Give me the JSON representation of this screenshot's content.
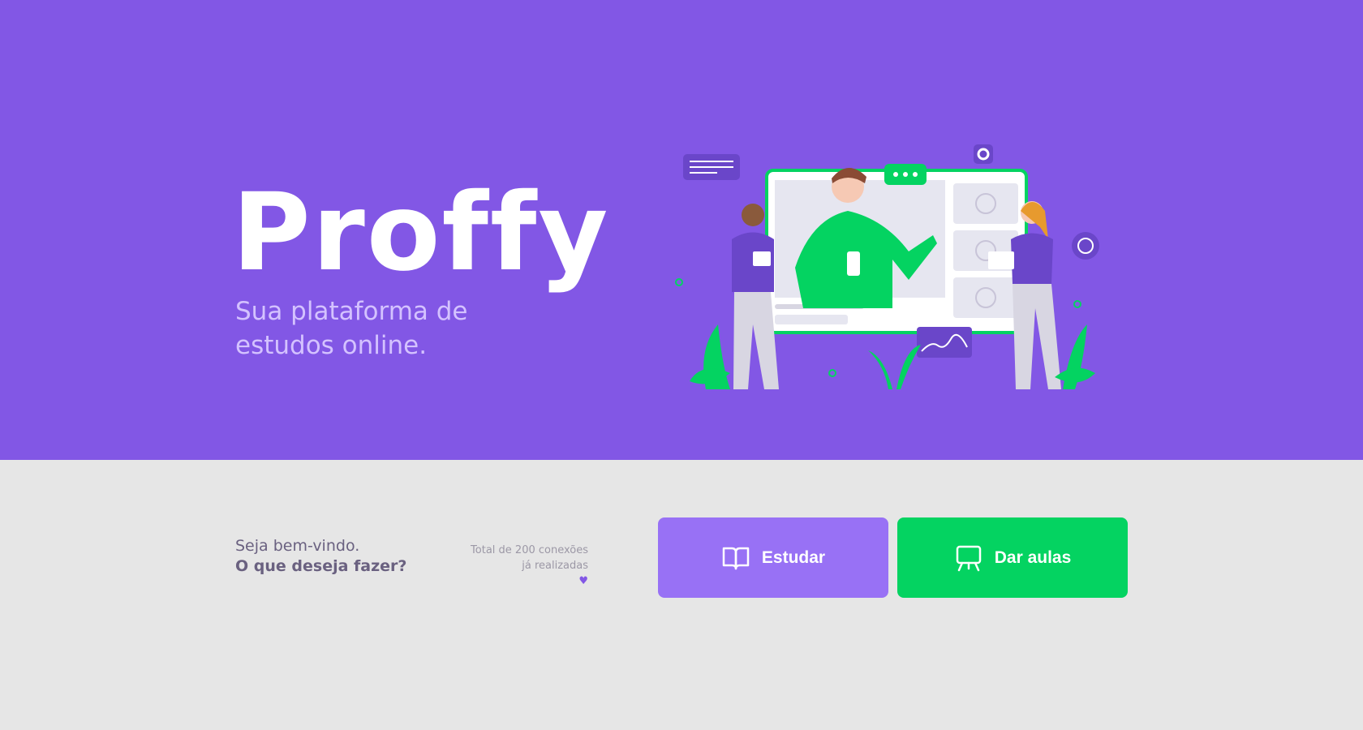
{
  "brand": {
    "logo_text": "Proffy",
    "tagline": "Sua plataforma de estudos online."
  },
  "welcome": {
    "line1": "Seja bem-vindo.",
    "line2": "O que deseja fazer?"
  },
  "connections": {
    "line1": "Total de 200 conexões",
    "line2": "já realizadas"
  },
  "actions": {
    "study_label": "Estudar",
    "teach_label": "Dar aulas"
  },
  "icons": {
    "study": "book-open-icon",
    "teach": "presentation-board-icon",
    "heart": "heart-icon"
  },
  "colors": {
    "primary": "#8257e5",
    "primary_light": "#9871f5",
    "secondary": "#04d361",
    "background": "#e6e6e6",
    "tagline": "#d4c2ff"
  }
}
